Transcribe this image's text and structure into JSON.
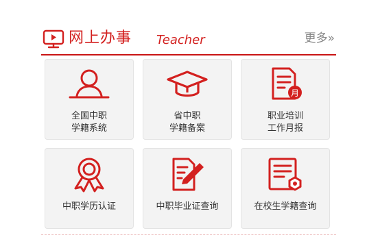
{
  "header": {
    "title": "网上办事",
    "subtitle": "Teacher",
    "more_link": "更多»",
    "icon": "monitor-icon"
  },
  "colors": {
    "accent": "#d3201f",
    "tile_bg": "#f3f3f3",
    "tile_border": "#e3e3e3",
    "text": "#333333",
    "muted": "#888888"
  },
  "services": [
    {
      "icon": "person-icon",
      "label_lines": [
        "全国中职",
        "学籍系统"
      ]
    },
    {
      "icon": "graduation-cap-icon",
      "label_lines": [
        "省中职",
        "学籍备案"
      ]
    },
    {
      "icon": "monthly-report-icon",
      "label_lines": [
        "职业培训",
        "工作月报"
      ]
    },
    {
      "icon": "award-ribbon-icon",
      "label_lines": [
        "中职学历认证"
      ]
    },
    {
      "icon": "document-edit-icon",
      "label_lines": [
        "中职毕业证查询"
      ]
    },
    {
      "icon": "certificate-search-icon",
      "label_lines": [
        "在校生学籍查询"
      ]
    }
  ],
  "report_badge": "月"
}
